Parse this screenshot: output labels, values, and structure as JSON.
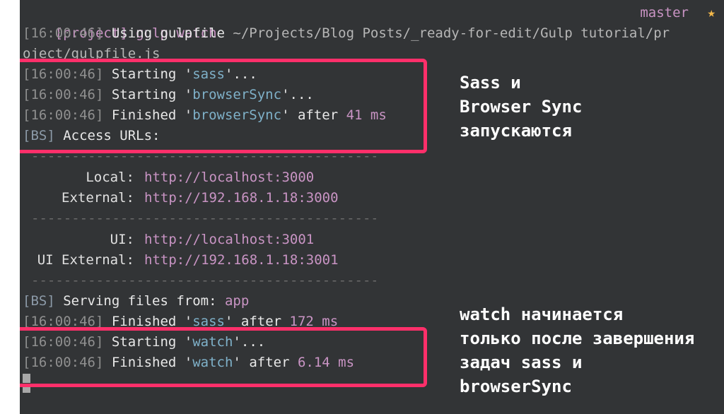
{
  "terminal": {
    "prompt": "[project] gulp watch",
    "branch": "master",
    "star": "★",
    "gulpfile_ts": "[16:00:46]",
    "gulpfile_text": " Using gulpfile ",
    "gulpfile_path_1": "~/Projects/Blog Posts/_ready-for-edit/Gulp tutorial/pr",
    "gulpfile_path_2": "oject/gulpfile.js",
    "ts": "[16:00:46]",
    "starting": " Starting '",
    "finished": " Finished '",
    "ellipsis": "'...",
    "after": "' after ",
    "task_sass": "sass",
    "task_browsersync": "browserSync",
    "task_watch": "watch",
    "browsersync_time": "41 ms",
    "sass_time": "172 ms",
    "watch_time": "6.14 ms",
    "bs_tag": "[BS]",
    "access_urls": " Access URLs:",
    "separator": "--------------------------------------------------------",
    "local_label": "Local:",
    "local_url": "http://localhost:3000",
    "external_label": "External:",
    "external_url": "http://192.168.1.18:3000",
    "ui_label": "UI:",
    "ui_url": "http://localhost:3001",
    "ui_external_label": "UI External:",
    "ui_external_url": "http://192.168.1.18:3001",
    "serving_text": " Serving files from: ",
    "serving_dir": "app"
  },
  "annotations": {
    "top_note": "Sass и\nBrowser Sync\nзапускаются",
    "bottom_note": "watch начинается\nтолько после завершения\nзадач sass и\nbrowserSync"
  },
  "colors": {
    "highlight": "#ff2f6a",
    "terminal_bg": "#323436",
    "accent_purple": "#c994c4",
    "accent_teal": "#7fb1c9"
  }
}
